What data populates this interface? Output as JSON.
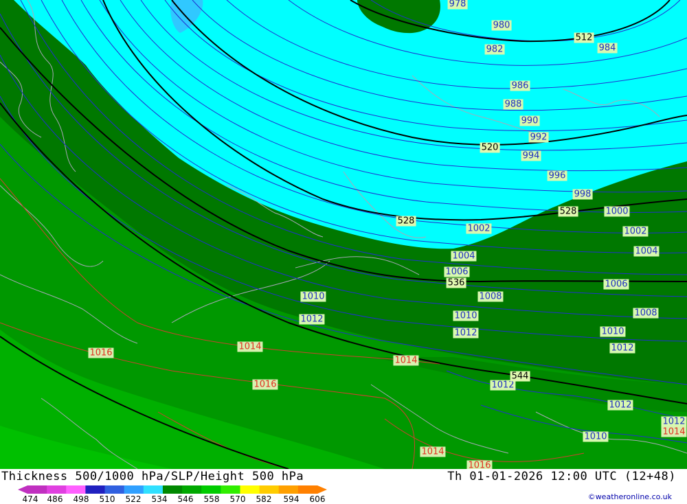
{
  "title": "Thickness 500/1000 hPa/SLP/Height 500 hPa",
  "datetime": "Th 01-01-2026 12:00 UTC (12+48)",
  "credit": "©weatheronline.co.uk",
  "scale": {
    "ticks": [
      "474",
      "486",
      "498",
      "510",
      "522",
      "534",
      "546",
      "558",
      "570",
      "582",
      "594",
      "606"
    ],
    "colors": [
      "#c030c0",
      "#e040e0",
      "#ff60ff",
      "#2020c0",
      "#3060e0",
      "#30a0ff",
      "#30e0ff",
      "#008800",
      "#00a800",
      "#00cc00",
      "#30ee00",
      "#ffff00",
      "#ffcc00",
      "#ffa000",
      "#ff8000"
    ]
  },
  "colors": {
    "thickness_lt522": "#00ffff",
    "thickness_522": "#30c8ff",
    "thickness_528_534": "#007800",
    "thickness_534_546": "#009800",
    "thickness_546_558": "#00b400",
    "isobar_low": "#2030d0",
    "isobar_high": "#e03020",
    "height_500": "#000000",
    "coast": "#a0a0b0"
  },
  "isobar_labels": [
    {
      "text": "978",
      "kind": "low"
    },
    {
      "text": "980",
      "kind": "low"
    },
    {
      "text": "982",
      "kind": "low"
    },
    {
      "text": "984",
      "kind": "low"
    },
    {
      "text": "986",
      "kind": "low"
    },
    {
      "text": "988",
      "kind": "low"
    },
    {
      "text": "990",
      "kind": "low"
    },
    {
      "text": "992",
      "kind": "low"
    },
    {
      "text": "994",
      "kind": "low"
    },
    {
      "text": "996",
      "kind": "low"
    },
    {
      "text": "998",
      "kind": "low"
    },
    {
      "text": "1000",
      "kind": "low"
    },
    {
      "text": "1002",
      "kind": "low"
    },
    {
      "text": "1002",
      "kind": "low"
    },
    {
      "text": "1004",
      "kind": "low"
    },
    {
      "text": "1004",
      "kind": "low"
    },
    {
      "text": "1006",
      "kind": "low"
    },
    {
      "text": "1006",
      "kind": "low"
    },
    {
      "text": "1008",
      "kind": "low"
    },
    {
      "text": "1008",
      "kind": "low"
    },
    {
      "text": "1010",
      "kind": "low"
    },
    {
      "text": "1010",
      "kind": "low"
    },
    {
      "text": "1010",
      "kind": "low"
    },
    {
      "text": "1010",
      "kind": "low"
    },
    {
      "text": "1012",
      "kind": "low"
    },
    {
      "text": "1012",
      "kind": "low"
    },
    {
      "text": "1012",
      "kind": "low"
    },
    {
      "text": "1012",
      "kind": "low"
    },
    {
      "text": "1012",
      "kind": "low"
    },
    {
      "text": "1012",
      "kind": "low"
    },
    {
      "text": "1014",
      "kind": "high"
    },
    {
      "text": "1014",
      "kind": "high"
    },
    {
      "text": "1014",
      "kind": "high"
    },
    {
      "text": "1014",
      "kind": "high"
    },
    {
      "text": "1016",
      "kind": "high"
    },
    {
      "text": "1016",
      "kind": "high"
    },
    {
      "text": "1016",
      "kind": "high"
    }
  ],
  "height_labels": [
    "512",
    "520",
    "528",
    "528",
    "536",
    "544"
  ]
}
